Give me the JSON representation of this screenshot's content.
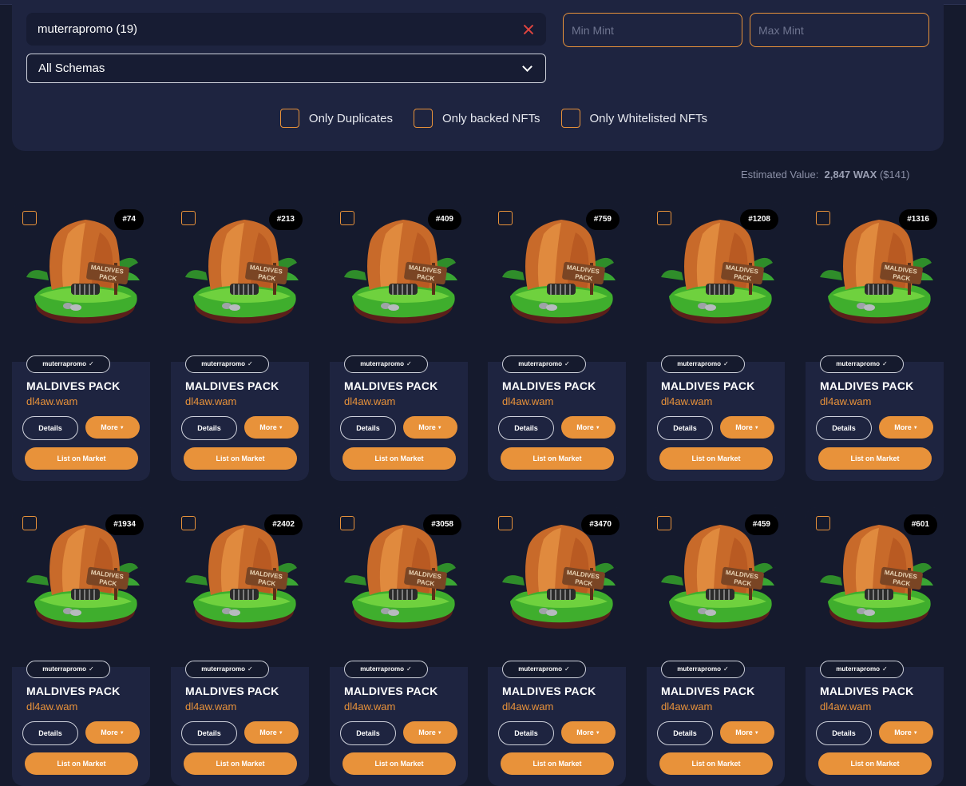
{
  "filters": {
    "collection_value": "muterrapromo (19)",
    "schema_value": "All Schemas",
    "min_mint_placeholder": "Min Mint",
    "max_mint_placeholder": "Max Mint",
    "checkboxes": [
      {
        "label": "Only Duplicates",
        "checked": false
      },
      {
        "label": "Only backed NFTs",
        "checked": false
      },
      {
        "label": "Only Whitelisted NFTs",
        "checked": false
      }
    ]
  },
  "estimate": {
    "label": "Estimated Value:",
    "amount": "2,847 WAX",
    "usd": "($141)"
  },
  "colors": {
    "accent": "#e8923a",
    "background": "#151a2d",
    "panel": "#1e2440",
    "clear": "#e0453f"
  },
  "card_labels": {
    "collection": "muterrapromo",
    "name": "MALDIVES PACK",
    "owner": "dl4aw.wam",
    "details": "Details",
    "more": "More",
    "list": "List on Market"
  },
  "cards": [
    {
      "mint": "#74"
    },
    {
      "mint": "#213"
    },
    {
      "mint": "#409"
    },
    {
      "mint": "#759"
    },
    {
      "mint": "#1208"
    },
    {
      "mint": "#1316"
    },
    {
      "mint": "#1934"
    },
    {
      "mint": "#2402"
    },
    {
      "mint": "#3058"
    },
    {
      "mint": "#3470"
    },
    {
      "mint": "#459"
    },
    {
      "mint": "#601"
    }
  ]
}
